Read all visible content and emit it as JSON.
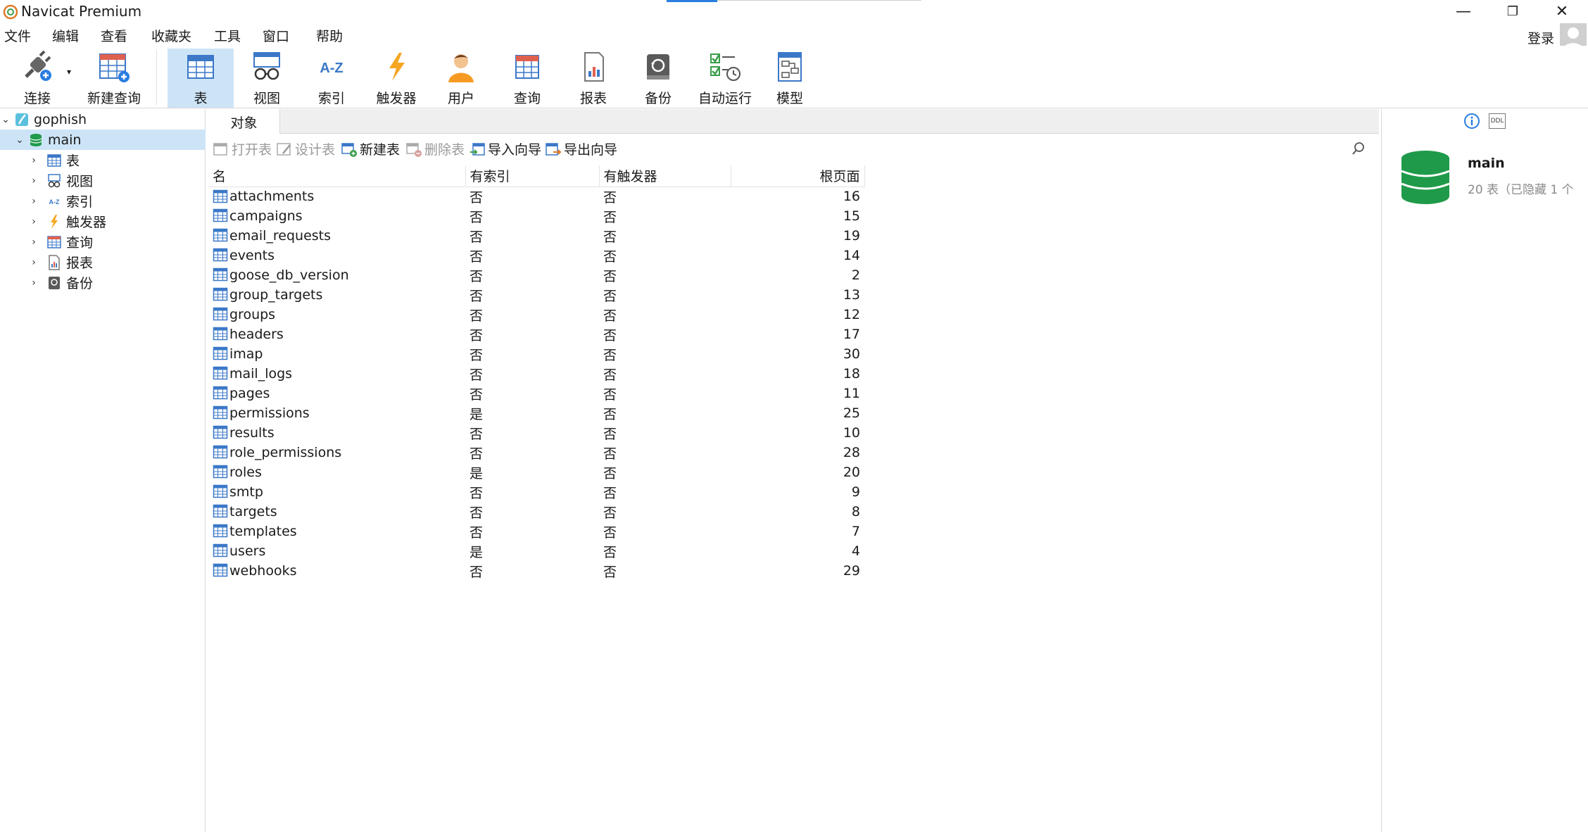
{
  "window": {
    "title": "Navicat Premium",
    "minimize": "—",
    "restore": "❐",
    "close": "✕"
  },
  "menu": [
    "文件",
    "编辑",
    "查看",
    "收藏夹",
    "工具",
    "窗口",
    "帮助"
  ],
  "account": {
    "login_label": "登录"
  },
  "ribbon": {
    "connect": "连接",
    "new_query": "新建查询",
    "table": "表",
    "view": "视图",
    "index": "索引",
    "trigger": "触发器",
    "user": "用户",
    "query": "查询",
    "report": "报表",
    "backup": "备份",
    "automation": "自动运行",
    "model": "模型"
  },
  "tree": {
    "connection": "gophish",
    "database": "main",
    "nodes": [
      "表",
      "视图",
      "索引",
      "触发器",
      "查询",
      "报表",
      "备份"
    ]
  },
  "tabs": {
    "objects": "对象"
  },
  "object_toolbar": {
    "open_table": "打开表",
    "design_table": "设计表",
    "new_table": "新建表",
    "delete_table": "删除表",
    "import_wizard": "导入向导",
    "export_wizard": "导出向导"
  },
  "table": {
    "columns": [
      "名",
      "有索引",
      "有触发器",
      "根页面"
    ],
    "rows": [
      [
        "attachments",
        "否",
        "否",
        "16"
      ],
      [
        "campaigns",
        "否",
        "否",
        "15"
      ],
      [
        "email_requests",
        "否",
        "否",
        "19"
      ],
      [
        "events",
        "否",
        "否",
        "14"
      ],
      [
        "goose_db_version",
        "否",
        "否",
        "2"
      ],
      [
        "group_targets",
        "否",
        "否",
        "13"
      ],
      [
        "groups",
        "否",
        "否",
        "12"
      ],
      [
        "headers",
        "否",
        "否",
        "17"
      ],
      [
        "imap",
        "否",
        "否",
        "30"
      ],
      [
        "mail_logs",
        "否",
        "否",
        "18"
      ],
      [
        "pages",
        "否",
        "否",
        "11"
      ],
      [
        "permissions",
        "是",
        "否",
        "25"
      ],
      [
        "results",
        "否",
        "否",
        "10"
      ],
      [
        "role_permissions",
        "否",
        "否",
        "28"
      ],
      [
        "roles",
        "是",
        "否",
        "20"
      ],
      [
        "smtp",
        "否",
        "否",
        "9"
      ],
      [
        "targets",
        "否",
        "否",
        "8"
      ],
      [
        "templates",
        "否",
        "否",
        "7"
      ],
      [
        "users",
        "是",
        "否",
        "4"
      ],
      [
        "webhooks",
        "否",
        "否",
        "29"
      ]
    ]
  },
  "info": {
    "ddl_label": "DDL",
    "name": "main",
    "description": "20 表（已隐藏 1 个"
  },
  "colors": {
    "accent": "#2b7de0",
    "selection": "#cde4f7",
    "db_green": "#1f9a4a",
    "table_icon_blue": "#3b78c8"
  }
}
